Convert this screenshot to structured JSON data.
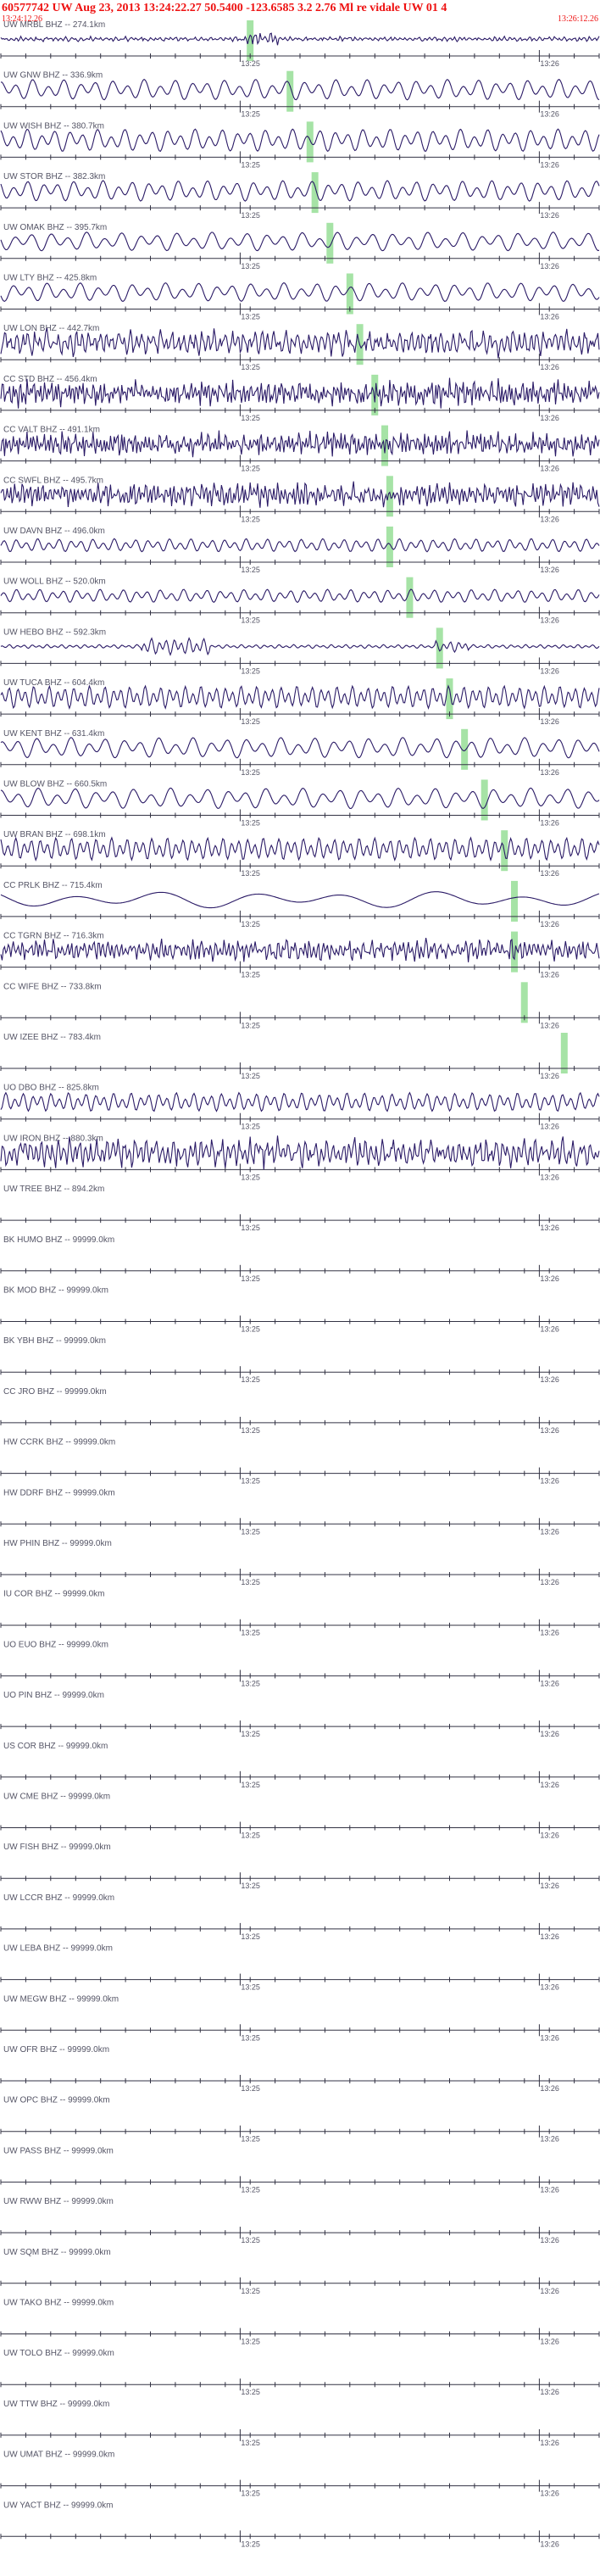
{
  "header": {
    "title": "60577742 UW Aug 23, 2013 13:24:22.27    50.5400  -123.6585  3.2 2.76 Ml re vidale UW 01   4",
    "time_start": "13:24:12.26",
    "time_end": "13:26:12.26"
  },
  "colors": {
    "header_text": "#ee1111",
    "trace": "#2a1a66",
    "axis": "#333344",
    "pick": "#a6e3a6",
    "label": "#555566"
  },
  "chart_data": {
    "type": "seismogram-record-section",
    "x_range_seconds": [
      0,
      120
    ],
    "x_ticks": [
      {
        "t": 48,
        "label": "13:25"
      },
      {
        "t": 108,
        "label": "13:26"
      }
    ],
    "stations": [
      {
        "label": "UW MRBL BHZ -- 274.1km",
        "pick_s": 50,
        "amp": 0.1,
        "period": 1.0,
        "has_data": true
      },
      {
        "label": "UW GNW BHZ -- 336.9km",
        "pick_s": 58,
        "amp": 0.55,
        "period": 3.2,
        "has_data": true
      },
      {
        "label": "UW WISH BHZ -- 380.7km",
        "pick_s": 62,
        "amp": 0.6,
        "period": 2.8,
        "has_data": true
      },
      {
        "label": "UW STOR BHZ -- 382.3km",
        "pick_s": 63,
        "amp": 0.55,
        "period": 3.0,
        "has_data": true
      },
      {
        "label": "UW OMAK BHZ -- 395.7km",
        "pick_s": 66,
        "amp": 0.5,
        "period": 3.6,
        "has_data": true
      },
      {
        "label": "UW LTY BHZ -- 425.8km",
        "pick_s": 70,
        "amp": 0.5,
        "period": 3.4,
        "has_data": true
      },
      {
        "label": "UW LON BHZ -- 442.7km",
        "pick_s": 72,
        "amp": 0.55,
        "period": 1.2,
        "has_data": true
      },
      {
        "label": "CC STD BHZ -- 456.4km",
        "pick_s": 75,
        "amp": 0.55,
        "period": 0.7,
        "has_data": true
      },
      {
        "label": "CC VALT BHZ -- 491.1km",
        "pick_s": 77,
        "amp": 0.5,
        "period": 0.7,
        "has_data": true
      },
      {
        "label": "CC SWFL BHZ -- 495.7km",
        "pick_s": 78,
        "amp": 0.5,
        "period": 0.8,
        "has_data": true
      },
      {
        "label": "UW DAVN BHZ -- 496.0km",
        "pick_s": 78,
        "amp": 0.35,
        "period": 2.2,
        "has_data": true
      },
      {
        "label": "UW WOLL BHZ -- 520.0km",
        "pick_s": 82,
        "amp": 0.35,
        "period": 2.4,
        "has_data": true
      },
      {
        "label": "UW HEBO BHZ -- 592.3km",
        "pick_s": 88,
        "amp": 0.1,
        "period": 1.5,
        "has_data": true
      },
      {
        "label": "UW TUCA BHZ -- 604.4km",
        "pick_s": 90,
        "amp": 0.6,
        "period": 1.6,
        "has_data": true
      },
      {
        "label": "UW KENT BHZ -- 631.4km",
        "pick_s": 93,
        "amp": 0.55,
        "period": 3.5,
        "has_data": true
      },
      {
        "label": "UW BLOW BHZ -- 660.5km",
        "pick_s": 97,
        "amp": 0.55,
        "period": 3.8,
        "has_data": true
      },
      {
        "label": "UW BRAN BHZ -- 698.1km",
        "pick_s": 101,
        "amp": 0.6,
        "period": 1.6,
        "has_data": true
      },
      {
        "label": "CC PRLK BHZ -- 715.4km",
        "pick_s": 103,
        "amp": 0.45,
        "period": 18.0,
        "has_data": true
      },
      {
        "label": "CC TGRN BHZ -- 716.3km",
        "pick_s": 103,
        "amp": 0.45,
        "period": 0.9,
        "has_data": true
      },
      {
        "label": "CC WIFE BHZ -- 733.8km",
        "pick_s": 105,
        "amp": 0.0,
        "period": 1.0,
        "has_data": false
      },
      {
        "label": "UW IZEE BHZ -- 783.4km",
        "pick_s": 113,
        "amp": 0.0,
        "period": 1.0,
        "has_data": false
      },
      {
        "label": "UO DBO BHZ -- 825.8km",
        "pick_s": null,
        "amp": 0.5,
        "period": 1.8,
        "has_data": true
      },
      {
        "label": "UW IRON BHZ -- 880.3km",
        "pick_s": null,
        "amp": 0.6,
        "period": 1.1,
        "has_data": true
      },
      {
        "label": "UW TREE BHZ -- 894.2km",
        "pick_s": null,
        "amp": 0,
        "period": 1,
        "has_data": false
      },
      {
        "label": "BK HUMO BHZ -- 99999.0km",
        "pick_s": null,
        "amp": 0,
        "period": 1,
        "has_data": false
      },
      {
        "label": "BK MOD BHZ -- 99999.0km",
        "pick_s": null,
        "amp": 0,
        "period": 1,
        "has_data": false
      },
      {
        "label": "BK YBH BHZ -- 99999.0km",
        "pick_s": null,
        "amp": 0,
        "period": 1,
        "has_data": false
      },
      {
        "label": "CC JRO BHZ -- 99999.0km",
        "pick_s": null,
        "amp": 0,
        "period": 1,
        "has_data": false
      },
      {
        "label": "HW CCRK BHZ -- 99999.0km",
        "pick_s": null,
        "amp": 0,
        "period": 1,
        "has_data": false
      },
      {
        "label": "HW DDRF BHZ -- 99999.0km",
        "pick_s": null,
        "amp": 0,
        "period": 1,
        "has_data": false
      },
      {
        "label": "HW PHIN BHZ -- 99999.0km",
        "pick_s": null,
        "amp": 0,
        "period": 1,
        "has_data": false
      },
      {
        "label": "IU COR BHZ -- 99999.0km",
        "pick_s": null,
        "amp": 0,
        "period": 1,
        "has_data": false
      },
      {
        "label": "UO EUO BHZ -- 99999.0km",
        "pick_s": null,
        "amp": 0,
        "period": 1,
        "has_data": false
      },
      {
        "label": "UO PIN BHZ -- 99999.0km",
        "pick_s": null,
        "amp": 0,
        "period": 1,
        "has_data": false
      },
      {
        "label": "US COR BHZ -- 99999.0km",
        "pick_s": null,
        "amp": 0,
        "period": 1,
        "has_data": false
      },
      {
        "label": "UW CME BHZ -- 99999.0km",
        "pick_s": null,
        "amp": 0,
        "period": 1,
        "has_data": false
      },
      {
        "label": "UW FISH BHZ -- 99999.0km",
        "pick_s": null,
        "amp": 0,
        "period": 1,
        "has_data": false
      },
      {
        "label": "UW LCCR BHZ -- 99999.0km",
        "pick_s": null,
        "amp": 0,
        "period": 1,
        "has_data": false
      },
      {
        "label": "UW LEBA BHZ -- 99999.0km",
        "pick_s": null,
        "amp": 0,
        "period": 1,
        "has_data": false
      },
      {
        "label": "UW MEGW BHZ -- 99999.0km",
        "pick_s": null,
        "amp": 0,
        "period": 1,
        "has_data": false
      },
      {
        "label": "UW OFR BHZ -- 99999.0km",
        "pick_s": null,
        "amp": 0,
        "period": 1,
        "has_data": false
      },
      {
        "label": "UW OPC BHZ -- 99999.0km",
        "pick_s": null,
        "amp": 0,
        "period": 1,
        "has_data": false
      },
      {
        "label": "UW PASS BHZ -- 99999.0km",
        "pick_s": null,
        "amp": 0,
        "period": 1,
        "has_data": false
      },
      {
        "label": "UW RWW BHZ -- 99999.0km",
        "pick_s": null,
        "amp": 0,
        "period": 1,
        "has_data": false
      },
      {
        "label": "UW SQM BHZ -- 99999.0km",
        "pick_s": null,
        "amp": 0,
        "period": 1,
        "has_data": false
      },
      {
        "label": "UW TAKO BHZ -- 99999.0km",
        "pick_s": null,
        "amp": 0,
        "period": 1,
        "has_data": false
      },
      {
        "label": "UW TOLO BHZ -- 99999.0km",
        "pick_s": null,
        "amp": 0,
        "period": 1,
        "has_data": false
      },
      {
        "label": "UW TTW BHZ -- 99999.0km",
        "pick_s": null,
        "amp": 0,
        "period": 1,
        "has_data": false
      },
      {
        "label": "UW UMAT BHZ -- 99999.0km",
        "pick_s": null,
        "amp": 0,
        "period": 1,
        "has_data": false
      },
      {
        "label": "UW YACT BHZ -- 99999.0km",
        "pick_s": null,
        "amp": 0,
        "period": 1,
        "has_data": false
      }
    ]
  }
}
